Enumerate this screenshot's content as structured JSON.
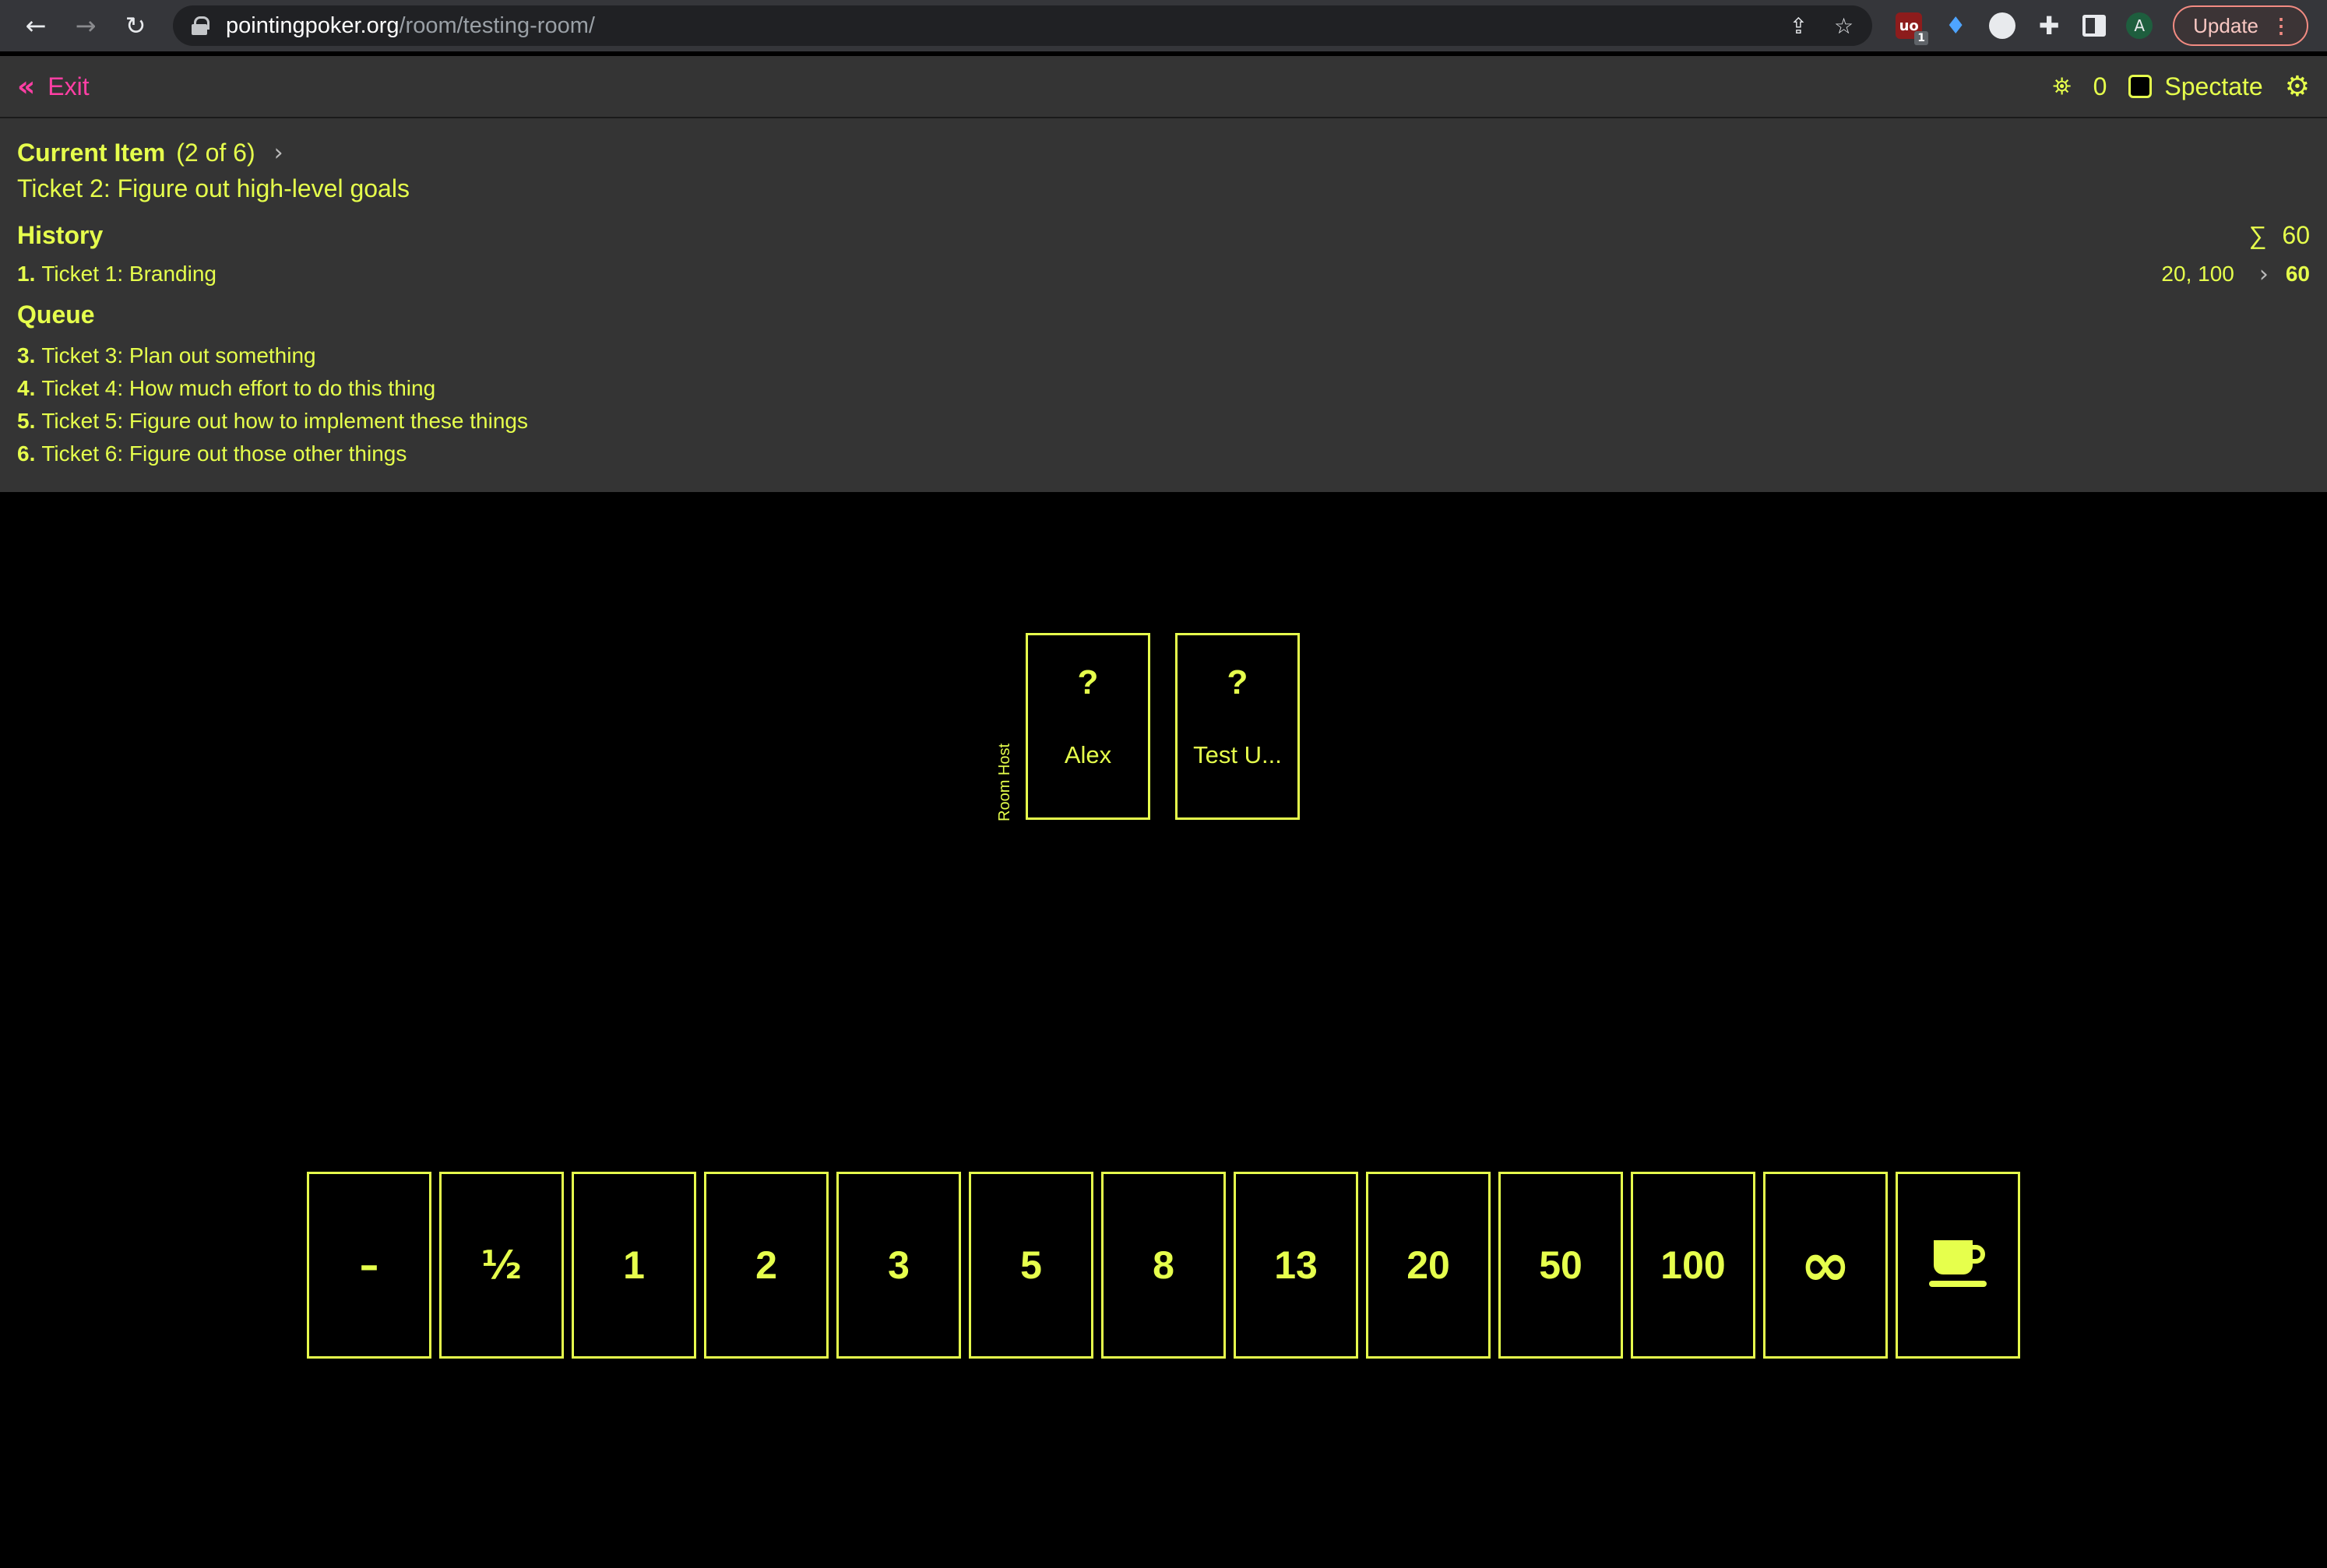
{
  "browser": {
    "url_host": "pointingpoker.org",
    "url_path": "/room/testing-room/",
    "update_label": "Update",
    "avatar_letter": "A",
    "ext_badge": "1"
  },
  "header": {
    "exit_label": "Exit",
    "spectator_count": "0",
    "spectate_label": "Spectate"
  },
  "current": {
    "title": "Current Item",
    "count": "(2 of 6)",
    "ticket": "Ticket 2: Figure out high-level goals"
  },
  "history": {
    "title": "History",
    "sum_symbol": "∑",
    "sum_value": "60",
    "items": [
      {
        "num": "1.",
        "label": "Ticket 1: Branding",
        "votes": "20, 100",
        "total": "60"
      }
    ]
  },
  "queue": {
    "title": "Queue",
    "items": [
      {
        "num": "3.",
        "label": "Ticket 3: Plan out something"
      },
      {
        "num": "4.",
        "label": "Ticket 4: How much effort to do this thing"
      },
      {
        "num": "5.",
        "label": "Ticket 5: Figure out how to implement these things"
      },
      {
        "num": "6.",
        "label": "Ticket 6: Figure out those other things"
      }
    ]
  },
  "table": {
    "host_label": "Room Host",
    "seats": [
      {
        "vote": "?",
        "name": "Alex"
      },
      {
        "vote": "?",
        "name": "Test U..."
      }
    ]
  },
  "deck": {
    "cards": [
      "–",
      "½",
      "1",
      "2",
      "3",
      "5",
      "8",
      "13",
      "20",
      "50",
      "100",
      "∞",
      "coffee-icon"
    ]
  },
  "colors": {
    "accent": "#e6ff4c",
    "exit": "#ff3fa4",
    "panel": "#343434",
    "background": "#000000"
  }
}
